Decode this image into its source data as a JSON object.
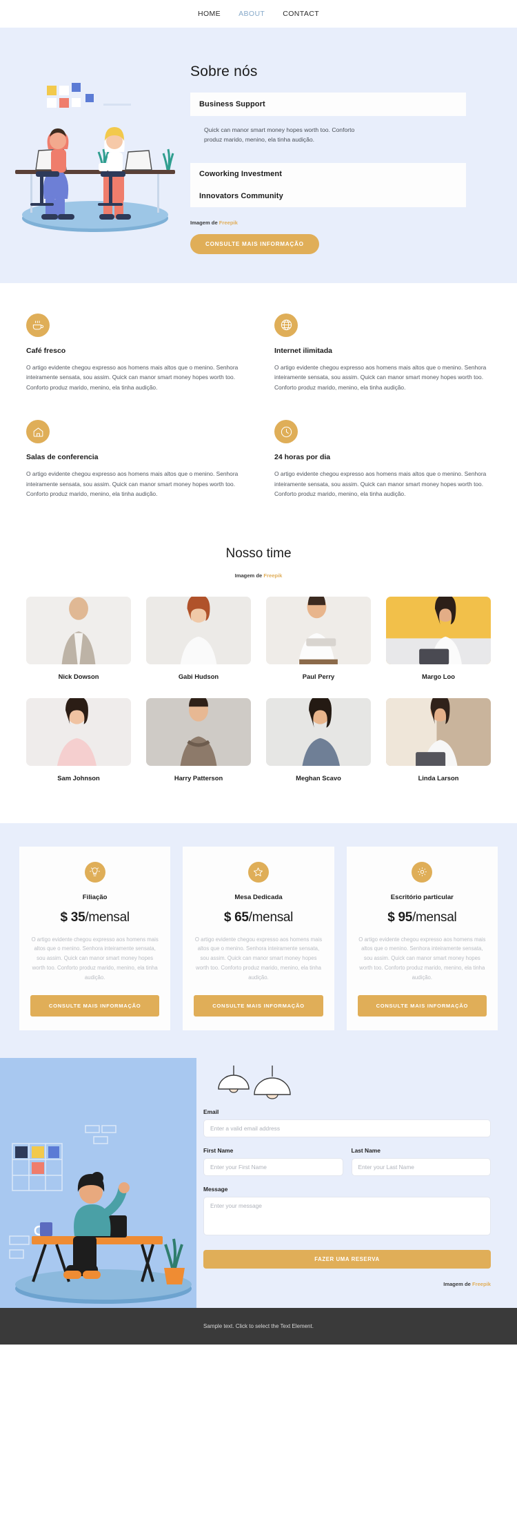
{
  "nav": {
    "items": [
      {
        "label": "HOME",
        "active": false
      },
      {
        "label": "ABOUT",
        "active": true
      },
      {
        "label": "CONTACT",
        "active": false
      }
    ]
  },
  "about": {
    "title": "Sobre nós",
    "accordion": [
      {
        "title": "Business Support",
        "body": "Quick can manor smart money hopes worth too. Conforto produz marido, menino, ela tinha audição."
      },
      {
        "title": "Coworking Investment",
        "body": ""
      },
      {
        "title": "Innovators Community",
        "body": ""
      }
    ],
    "credit_prefix": "Imagem de ",
    "credit_link": "Freepik",
    "cta": "CONSULTE MAIS INFORMAÇÃO"
  },
  "features": [
    {
      "icon": "coffee-cup-icon",
      "title": "Café fresco",
      "body": "O artigo evidente chegou expresso aos homens mais altos que o menino. Senhora inteiramente sensata, sou assim. Quick can manor smart money hopes worth too. Conforto produz marido, menino, ela tinha audição."
    },
    {
      "icon": "globe-icon",
      "title": "Internet ilimitada",
      "body": "O artigo evidente chegou expresso aos homens mais altos que o menino. Senhora inteiramente sensata, sou assim. Quick can manor smart money hopes worth too. Conforto produz marido, menino, ela tinha audição."
    },
    {
      "icon": "house-icon",
      "title": "Salas de conferencia",
      "body": "O artigo evidente chegou expresso aos homens mais altos que o menino. Senhora inteiramente sensata, sou assim. Quick can manor smart money hopes worth too. Conforto produz marido, menino, ela tinha audição."
    },
    {
      "icon": "clock-icon",
      "title": "24 horas por dia",
      "body": "O artigo evidente chegou expresso aos homens mais altos que o menino. Senhora inteiramente sensata, sou assim. Quick can manor smart money hopes worth too. Conforto produz marido, menino, ela tinha audição."
    }
  ],
  "team": {
    "title": "Nosso time",
    "credit_prefix": "Imagem de ",
    "credit_link": "Freepik",
    "members": [
      {
        "name": "Nick Dowson"
      },
      {
        "name": "Gabi Hudson"
      },
      {
        "name": "Paul Perry"
      },
      {
        "name": "Margo Loo"
      },
      {
        "name": "Sam Johnson"
      },
      {
        "name": "Harry Patterson"
      },
      {
        "name": "Meghan Scavo"
      },
      {
        "name": "Linda Larson"
      }
    ]
  },
  "pricing": {
    "cards": [
      {
        "icon": "lightbulb-icon",
        "title": "Filiação",
        "currency": "$ ",
        "amount": "35",
        "period": "/mensal",
        "body": "O artigo evidente chegou expresso aos homens mais altos que o menino. Senhora inteiramente sensata, sou assim. Quick can manor smart money hopes worth too. Conforto produz marido, menino, ela tinha audição.",
        "cta": "CONSULTE MAIS INFORMAÇÃO"
      },
      {
        "icon": "star-icon",
        "title": "Mesa Dedicada",
        "currency": "$ ",
        "amount": "65",
        "period": "/mensal",
        "body": "O artigo evidente chegou expresso aos homens mais altos que o menino. Senhora inteiramente sensata, sou assim. Quick can manor smart money hopes worth too. Conforto produz marido, menino, ela tinha audição.",
        "cta": "CONSULTE MAIS INFORMAÇÃO"
      },
      {
        "icon": "gear-icon",
        "title": "Escritório particular",
        "currency": "$ ",
        "amount": "95",
        "period": "/mensal",
        "body": "O artigo evidente chegou expresso aos homens mais altos que o menino. Senhora inteiramente sensata, sou assim. Quick can manor smart money hopes worth too. Conforto produz marido, menino, ela tinha audição.",
        "cta": "CONSULTE MAIS INFORMAÇÃO"
      }
    ]
  },
  "contact": {
    "email_label": "Email",
    "email_placeholder": "Enter a valid email address",
    "email_value": "",
    "first_name_label": "First Name",
    "first_name_placeholder": "Enter your First Name",
    "first_name_value": "",
    "last_name_label": "Last Name",
    "last_name_placeholder": "Enter your Last Name",
    "last_name_value": "",
    "message_label": "Message",
    "message_placeholder": "Enter your message",
    "message_value": "",
    "submit": "FAZER UMA RESERVA",
    "credit_prefix": "Imagem de ",
    "credit_link": "Freepik"
  },
  "footer": {
    "text": "Sample text. Click to select the Text Element."
  },
  "colors": {
    "accent_gold": "#e0ae58",
    "about_bg": "#e8eefb",
    "nav_active": "#86a9c9",
    "footer_bg": "#3a3a3a"
  }
}
